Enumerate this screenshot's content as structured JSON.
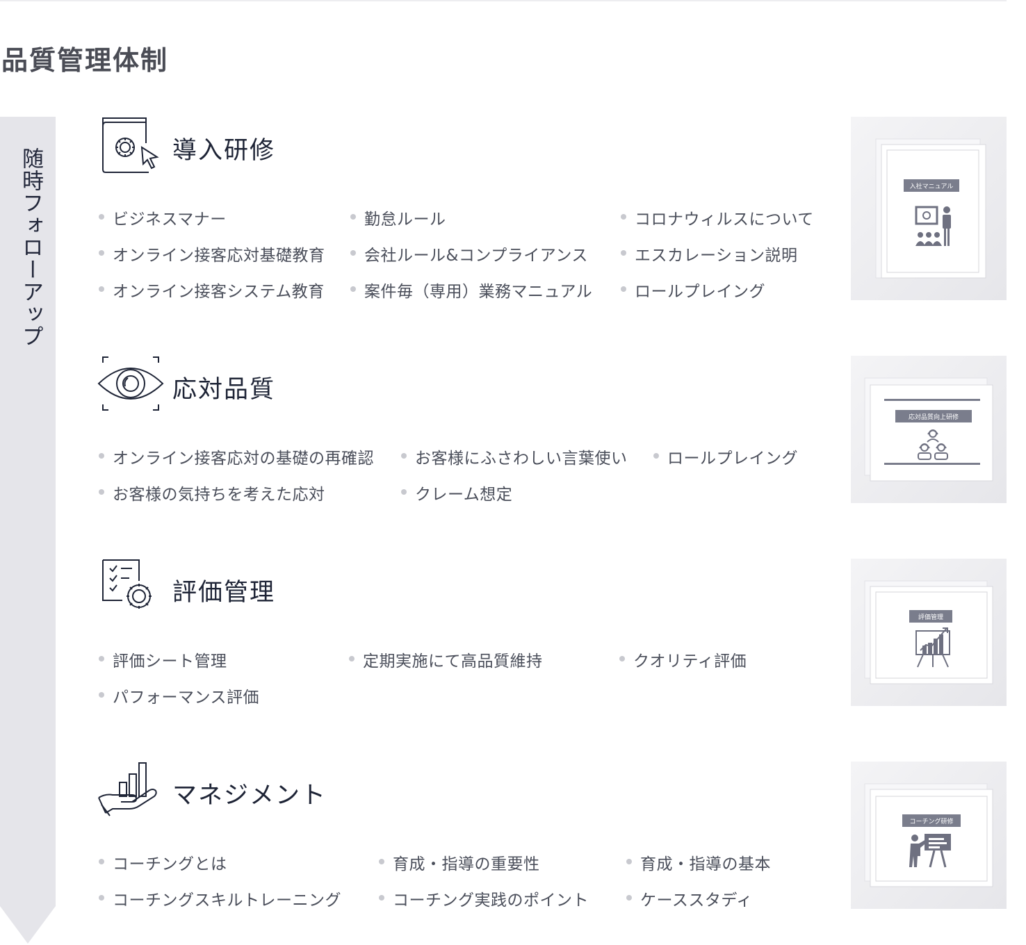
{
  "page": {
    "title": "品質管理体制"
  },
  "followup": {
    "label": "随時フォローアップ"
  },
  "sections": [
    {
      "title": "導入研修",
      "icon": "book-gear-cursor-icon",
      "items": [
        "ビジネスマナー",
        "勤怠ルール",
        "コロナウィルスについて",
        "オンライン接客応対基礎教育",
        "会社ルール&コンプライアンス",
        "エスカレーション説明",
        "オンライン接客システム教育",
        "案件毎（専用）業務マニュアル",
        "ロールプレイング"
      ],
      "thumb_label": "入社マニュアル",
      "thumb_icon": "presenter-audience-icon"
    },
    {
      "title": "応対品質",
      "icon": "eye-scan-icon",
      "items": [
        "オンライン接客応対の基礎の再確認",
        "お客様にふさわしい言葉使い",
        "ロールプレイング",
        "お客様の気持ちを考えた応対",
        "クレーム想定"
      ],
      "thumb_label": "応対品質向上研修",
      "thumb_icon": "headset-operators-icon"
    },
    {
      "title": "評価管理",
      "icon": "checklist-gear-icon",
      "items": [
        "評価シート管理",
        "定期実施にて高品質維持",
        "クオリティ評価",
        "パフォーマンス評価"
      ],
      "thumb_label": "評価管理",
      "thumb_icon": "growth-chart-easel-icon"
    },
    {
      "title": "マネジメント",
      "icon": "hand-bar-chart-icon",
      "items": [
        "コーチングとは",
        "育成・指導の重要性",
        "育成・指導の基本",
        "コーチングスキルトレーニング",
        "コーチング実践のポイント",
        "ケーススタディ"
      ],
      "thumb_label": "コーチング研修",
      "thumb_icon": "teacher-whiteboard-icon"
    }
  ],
  "colors": {
    "accent_navy": "#1e2436",
    "arrow_gray": "#e5e5ea",
    "bullet_gray": "#c8c9cf",
    "thumb_label_bg": "#7a7d8c"
  }
}
